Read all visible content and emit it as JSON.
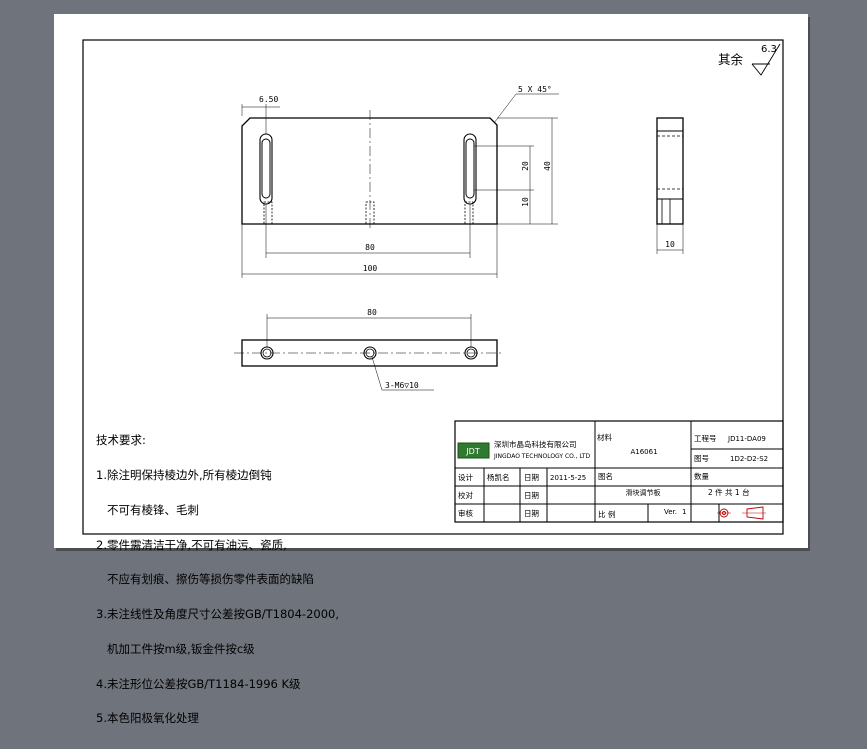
{
  "surface_finish": {
    "label": "其余",
    "value": "6.3"
  },
  "dimensions": {
    "slot_offset": "6.50",
    "chamfer": "5 X 45°",
    "height_total": "40",
    "slot_length": "20",
    "hole_offset": "10",
    "slot_pitch": "80",
    "overall_length": "100",
    "side_thickness": "10",
    "bottom_pitch": "80",
    "thread_callout": "3-M6▽10"
  },
  "tech_notes": {
    "title": "技术要求:",
    "line1": "1.除注明保持棱边外,所有棱边倒钝",
    "line2": "   不可有棱锋、毛刺",
    "line3": "2.零件需清洁干净,不可有油污、瓷质,",
    "line4": "   不应有划痕、擦伤等损伤零件表面的缺陷",
    "line5": "3.未注线性及角度尺寸公差按GB/T1804-2000,",
    "line6": "   机加工件按m级,钣金件按c级",
    "line7": "4.未注形位公差按GB/T1184-1996 K级",
    "line8": "5.本色阳极氧化处理"
  },
  "title_block": {
    "company_cn": "深圳市晶岛科技有限公司",
    "company_en": "JINGDAO TECHNOLOGY CO., LTD",
    "logo_text": "JDT",
    "material_label": "材料",
    "material_value": "A16061",
    "project_no_label": "工程号",
    "project_no_value": "JD11-DA09",
    "drawing_no_label": "图号",
    "drawing_no_value": "1D2-D2-S2",
    "design_label": "设计",
    "designer": "杨凯名",
    "date_label": "日期",
    "date_value": "2011-5-25",
    "part_name_label": "图名",
    "part_name_value": "滑块调节板",
    "quantity_label": "数量",
    "quantity_value": "2  件    共 1 台",
    "check_label": "校对",
    "date2_label": "日期",
    "approve_label": "审核",
    "date3_label": "日期",
    "scale_label": "比 例",
    "version_label": "Ver.",
    "version_value": "1"
  },
  "colors": {
    "viewport_background": "#6f737b",
    "sheet": "#ffffff",
    "line": "#000000",
    "logo_green": "#2f7a2f",
    "symbol_red": "#c00000"
  }
}
